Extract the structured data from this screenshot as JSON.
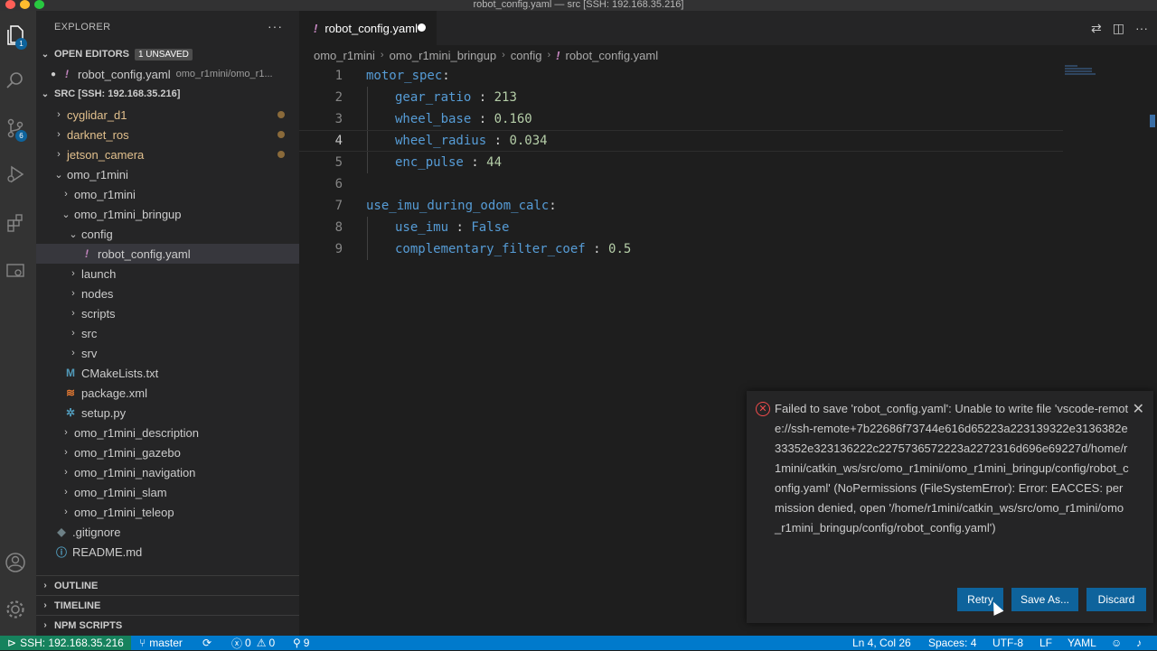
{
  "window": {
    "title": "robot_config.yaml — src [SSH: 192.168.35.216]"
  },
  "activity_bar": {
    "explorer_badge": "1",
    "scm_badge": "6"
  },
  "sidebar": {
    "header": "EXPLORER",
    "more": "···",
    "open_editors": {
      "title": "OPEN EDITORS",
      "badge": "1 UNSAVED",
      "file": "robot_config.yaml",
      "path": "omo_r1mini/omo_r1..."
    },
    "src": {
      "title": "SRC [SSH: 192.168.35.216]"
    },
    "tree": [
      {
        "label": "cyglidar_d1"
      },
      {
        "label": "darknet_ros"
      },
      {
        "label": "jetson_camera"
      },
      {
        "label": "omo_r1mini"
      },
      {
        "label": "omo_r1mini"
      },
      {
        "label": "omo_r1mini_bringup"
      },
      {
        "label": "config"
      },
      {
        "label": "robot_config.yaml"
      },
      {
        "label": "launch"
      },
      {
        "label": "nodes"
      },
      {
        "label": "scripts"
      },
      {
        "label": "src"
      },
      {
        "label": "srv"
      },
      {
        "label": "CMakeLists.txt"
      },
      {
        "label": "package.xml"
      },
      {
        "label": "setup.py"
      },
      {
        "label": "omo_r1mini_description"
      },
      {
        "label": "omo_r1mini_gazebo"
      },
      {
        "label": "omo_r1mini_navigation"
      },
      {
        "label": "omo_r1mini_slam"
      },
      {
        "label": "omo_r1mini_teleop"
      },
      {
        "label": ".gitignore"
      },
      {
        "label": "README.md"
      }
    ],
    "outline": "OUTLINE",
    "timeline": "TIMELINE",
    "npm_scripts": "NPM SCRIPTS"
  },
  "editor": {
    "tab_label": "robot_config.yaml",
    "breadcrumb": [
      "omo_r1mini",
      "omo_r1mini_bringup",
      "config",
      "robot_config.yaml"
    ],
    "lines": [
      {
        "num": "1",
        "key": "motor_spec",
        "sep": ":",
        "value": ""
      },
      {
        "num": "2",
        "key": "gear_ratio",
        "sep": " : ",
        "value": "213"
      },
      {
        "num": "3",
        "key": "wheel_base",
        "sep": " : ",
        "value": "0.160"
      },
      {
        "num": "4",
        "key": "wheel_radius",
        "sep": " : ",
        "value": "0.034"
      },
      {
        "num": "5",
        "key": "enc_pulse",
        "sep": " : ",
        "value": "44"
      },
      {
        "num": "6",
        "key": "",
        "sep": "",
        "value": ""
      },
      {
        "num": "7",
        "key": "use_imu_during_odom_calc",
        "sep": ":",
        "value": ""
      },
      {
        "num": "8",
        "key": "use_imu",
        "sep": " : ",
        "value": "False"
      },
      {
        "num": "9",
        "key": "complementary_filter_coef",
        "sep": " : ",
        "value": "0.5"
      }
    ]
  },
  "notification": {
    "message": "Failed to save 'robot_config.yaml': Unable to write file 'vscode-remote://ssh-remote+7b22686f73744e616d65223a223139322e3136382e33352e323136222c2275736572223a2272316d696e69227d/home/r1mini/catkin_ws/src/omo_r1mini/omo_r1mini_bringup/config/robot_config.yaml' (NoPermissions (FileSystemError): Error: EACCES: permission denied, open '/home/r1mini/catkin_ws/src/omo_r1mini/omo_r1mini_bringup/config/robot_config.yaml')",
    "retry": "Retry",
    "save_as": "Save As...",
    "discard": "Discard"
  },
  "statusbar": {
    "remote": "SSH: 192.168.35.216",
    "branch": "master",
    "errors": "0",
    "warnings": "0",
    "ports": "9",
    "position": "Ln 4, Col 26",
    "spaces": "Spaces: 4",
    "encoding": "UTF-8",
    "eol": "LF",
    "language": "YAML"
  },
  "colors": {
    "accent": "#007acc",
    "remote": "#16825d",
    "button": "#0e639c",
    "error": "#f14c4c",
    "key": "#569cd6",
    "number": "#b5cea8"
  }
}
